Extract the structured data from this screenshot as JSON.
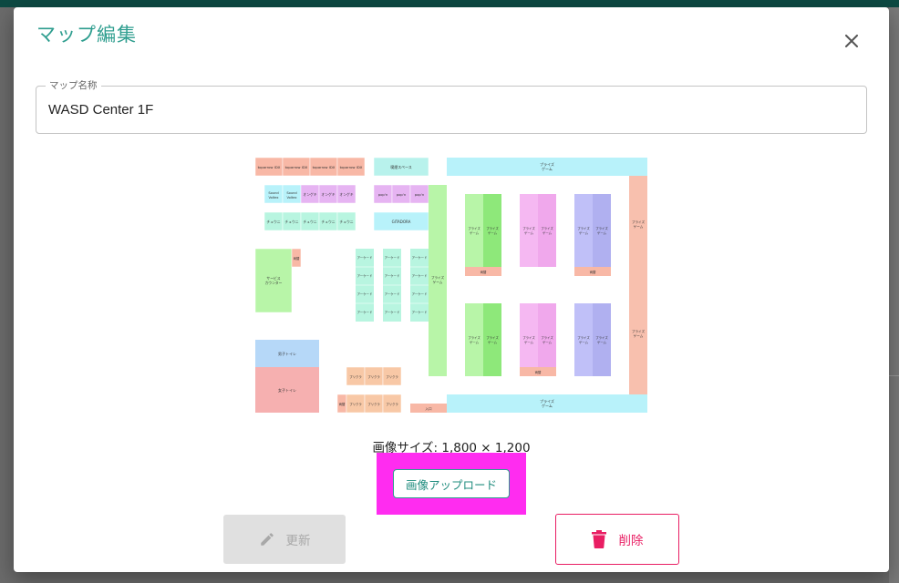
{
  "dialog": {
    "title": "マップ編集",
    "close_icon": "close-icon"
  },
  "map_name_field": {
    "label": "マップ名称",
    "value": "WASD Center 1F"
  },
  "preview": {
    "image_size_text": "画像サイズ: 1,800 × 1,200",
    "labels": {
      "toparrow": "toparrow IDX",
      "prize_game": "プライズゲーム",
      "prize": "プライズ",
      "game": "ゲーム",
      "smoking": "喫煙スペース",
      "sound_voltex": "Sound Voltex",
      "ongeki": "オンゲキ",
      "popn": "pop'n",
      "chunithm": "チュウニ",
      "gitadora": "GITADORA",
      "arcade": "アーケード",
      "service_counter": "サービスカウンター",
      "service": "サービス",
      "counter": "カウンター",
      "toilet_m": "男子トイレ",
      "toilet_f": "女子トイレ",
      "purikura": "プリクラ",
      "entrance": "入口",
      "exchange": "両替"
    }
  },
  "actions": {
    "upload_label": "画像アップロード",
    "update_label": "更新",
    "delete_label": "削除",
    "update_icon": "pencil-icon",
    "delete_icon": "trash-icon"
  },
  "colors": {
    "accent": "#2f9e8f",
    "danger": "#e91e63",
    "highlight": "#ff2cf0",
    "disabled_bg": "#e0e0e0"
  }
}
